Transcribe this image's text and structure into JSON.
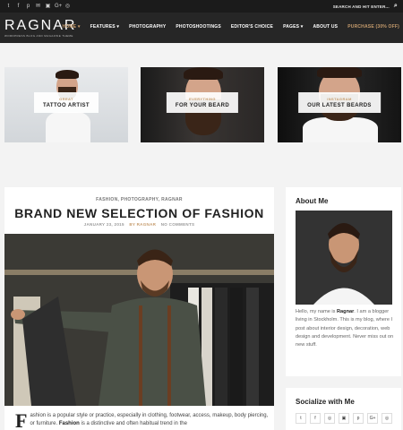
{
  "topbar": {
    "social_icons": [
      "twitter-icon",
      "facebook-icon",
      "pinterest-icon",
      "flickr-icon",
      "vimeo-icon",
      "google-plus-icon",
      "instagram-icon"
    ],
    "social_glyphs": [
      "t",
      "f",
      "p",
      "✉",
      "▣",
      "G+",
      "◎"
    ],
    "search_placeholder": "SEARCH AND HIT ENTER..."
  },
  "header": {
    "logo": "RAGNAR",
    "tagline": "WORDPRESS BLOG AND MAGAZINE THEME",
    "nav": [
      {
        "label": "HOME ▾"
      },
      {
        "label": "FEATURES ▾"
      },
      {
        "label": "PHOTOGRAPHY"
      },
      {
        "label": "PHOTOSHOOTINGS"
      },
      {
        "label": "EDITOR'S CHOICE"
      },
      {
        "label": "PAGES ▾"
      },
      {
        "label": "ABOUT US"
      },
      {
        "label": "PURCHASE (30% OFF)"
      }
    ]
  },
  "promos": [
    {
      "small": "GREAT",
      "large": "TATTOO ARTIST"
    },
    {
      "small": "EVERYTHING",
      "large": "FOR YOUR BEARD"
    },
    {
      "small": "INSTAGRAM",
      "large": "OUR LATEST BEARDS"
    }
  ],
  "post": {
    "categories": "FASHION, PHOTOGRAPHY, RAGNAR",
    "title": "BRAND NEW SELECTION OF FASHION",
    "date": "JANUARY 23, 2015",
    "author": "BY RAGNAR",
    "comments": "NO COMMENTS",
    "dropcap": "F",
    "body_1": "ashion is a popular style or practice, especially in clothing, footwear, access, makeup, body piercing, or furniture. ",
    "body_bold": "Fashion",
    "body_2": " is a distinctive and often habitual trend in the"
  },
  "sidebar": {
    "about_title": "About Me",
    "about_1": "Hello, my name is ",
    "about_name": "Ragnar",
    "about_2": ". I am a blogger living in Stockholm. This is my blog, where I post about interior design, decoration, web design and development. Never miss out on new stuff.",
    "socialize_title": "Socialize with Me",
    "socialize_icons": [
      "twitter-icon",
      "facebook-icon",
      "vimeo-icon",
      "flickr-icon",
      "pinterest-icon",
      "google-plus-icon",
      "instagram-icon"
    ],
    "socialize_glyphs": [
      "t",
      "f",
      "◎",
      "▣",
      "p",
      "G+",
      "◎"
    ]
  },
  "colors": {
    "accent": "#c69c6d",
    "dark": "#262626",
    "topbar": "#1b1b1b"
  }
}
